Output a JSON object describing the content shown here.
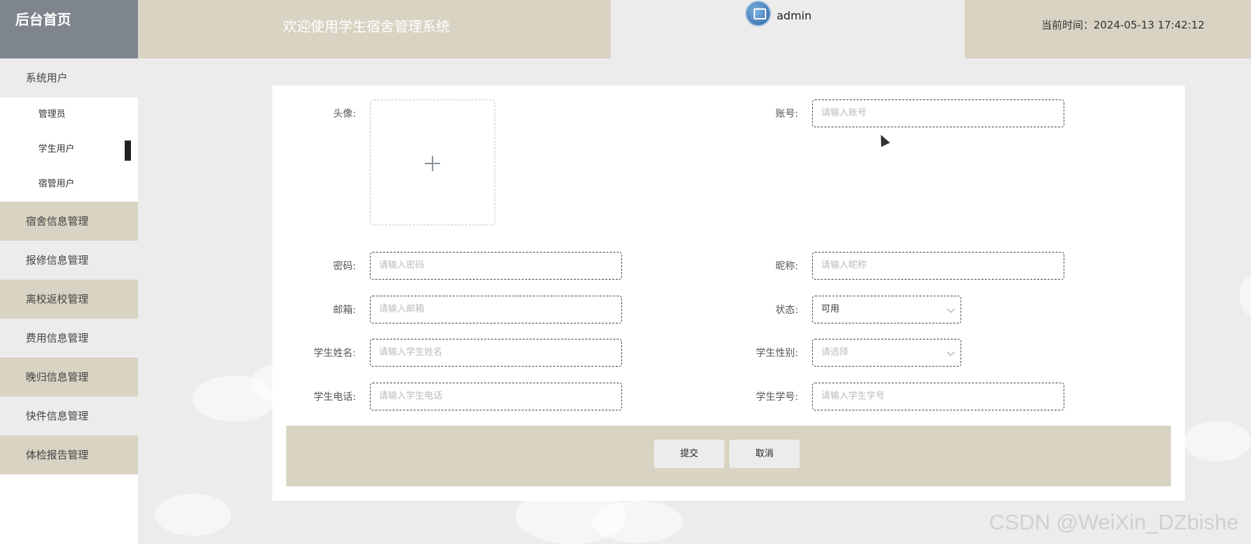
{
  "header": {
    "brand": "后台首页",
    "welcome": "欢迎使用学生宿舍管理系统",
    "username": "admin",
    "time_label": "当前时间：",
    "time_value": "2024-05-13 17:42:12"
  },
  "sidebar": {
    "group": "系统用户",
    "sub_items": [
      "管理员",
      "学生用户",
      "宿管用户"
    ],
    "items": [
      "宿舍信息管理",
      "报修信息管理",
      "离校返校管理",
      "费用信息管理",
      "晚归信息管理",
      "快件信息管理",
      "体检报告管理"
    ]
  },
  "form": {
    "avatar_label": "头像:",
    "account_label": "账号:",
    "account_placeholder": "请输入账号",
    "password_label": "密码:",
    "password_placeholder": "请输入密码",
    "nickname_label": "昵称:",
    "nickname_placeholder": "请输入昵称",
    "email_label": "邮箱:",
    "email_placeholder": "请输入邮箱",
    "status_label": "状态:",
    "status_value": "可用",
    "student_name_label": "学生姓名:",
    "student_name_placeholder": "请输入学生姓名",
    "gender_label": "学生性别:",
    "gender_placeholder": "请选择",
    "phone_label": "学生电话:",
    "phone_placeholder": "请输入学生电话",
    "student_no_label": "学生学号:",
    "student_no_placeholder": "请输入学生学号",
    "submit": "提交",
    "cancel": "取消"
  },
  "watermark": "CSDN @WeiXin_DZbishe",
  "colors": {
    "beige": "#d8d3c2",
    "grey": "#ececec",
    "brand_bg": "#7f858d"
  }
}
